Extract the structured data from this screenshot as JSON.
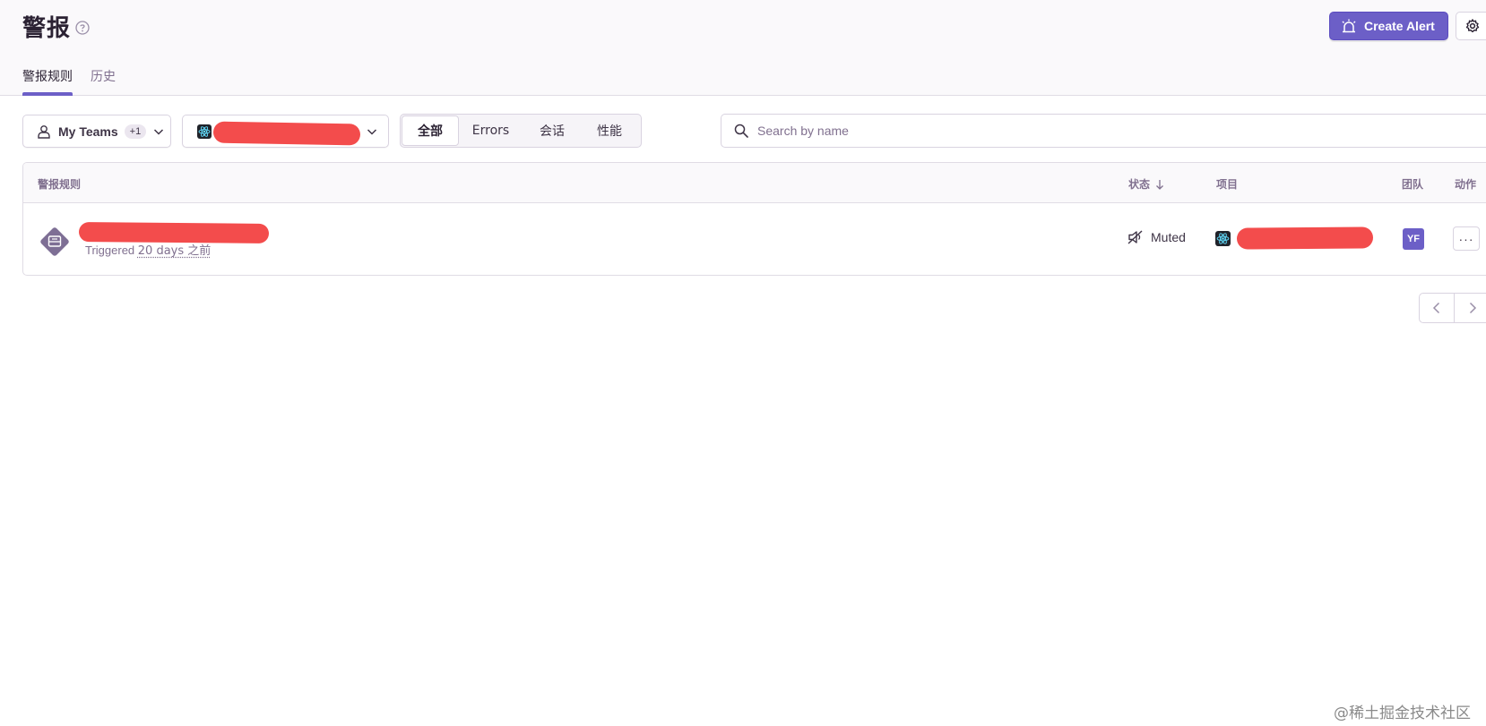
{
  "header": {
    "title": "警报",
    "create_alert_label": "Create Alert"
  },
  "tabs": [
    {
      "label": "警报规则",
      "active": true
    },
    {
      "label": "历史",
      "active": false
    }
  ],
  "filters": {
    "teams_label": "My Teams",
    "teams_badge": "+1",
    "project_name_redacted": true,
    "segments": [
      {
        "label": "全部",
        "active": true
      },
      {
        "label": "Errors",
        "active": false
      },
      {
        "label": "会话",
        "active": false
      },
      {
        "label": "性能",
        "active": false
      }
    ],
    "search_placeholder": "Search by name"
  },
  "table": {
    "columns": {
      "rule": "警报规则",
      "status": "状态",
      "project": "项目",
      "team": "团队",
      "actions": "动作"
    },
    "rows": [
      {
        "name_redacted": true,
        "triggered_prefix": "Triggered",
        "triggered_time": "20 days 之前",
        "status": "Muted",
        "project_redacted": true,
        "team": "YF",
        "actions_label": "···"
      }
    ]
  },
  "watermark": "@稀土掘金技术社区",
  "colors": {
    "accent": "#6c5fc7",
    "redaction": "#f34c4c",
    "header_bg": "#faf9fb",
    "border": "#d9d3e0",
    "muted_text": "#80708f"
  },
  "icons": [
    "help-icon",
    "siren-icon",
    "gear-icon",
    "user-icon",
    "chevron-down-icon",
    "react-icon",
    "search-icon",
    "sort-arrow-down-icon",
    "alert-rule-icon",
    "mute-icon",
    "chevron-left-icon",
    "chevron-right-icon"
  ]
}
